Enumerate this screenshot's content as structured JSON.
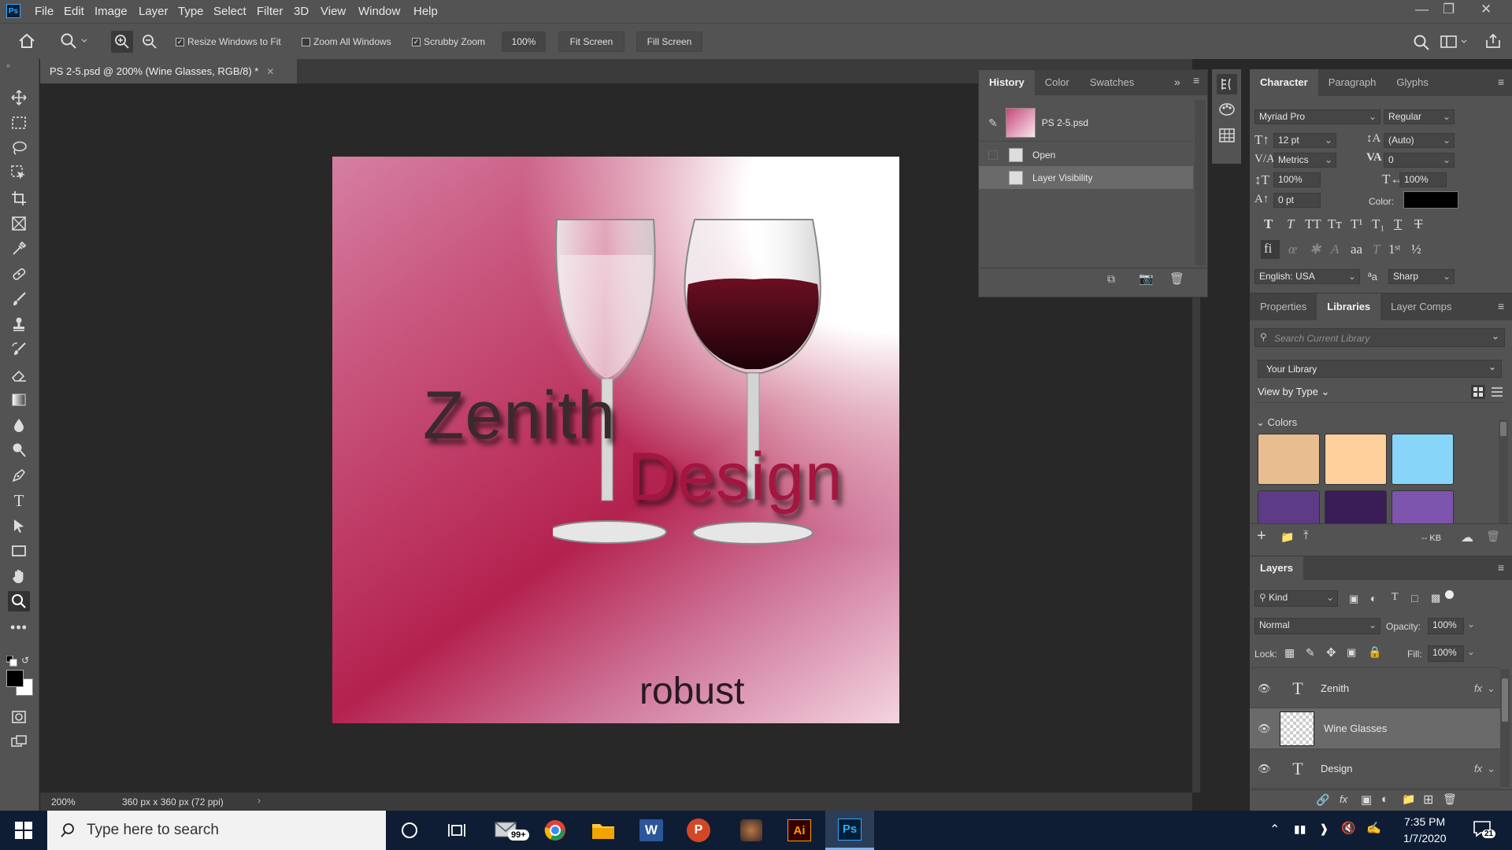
{
  "menubar": {
    "logo": "Ps",
    "items": [
      "File",
      "Edit",
      "Image",
      "Layer",
      "Type",
      "Select",
      "Filter",
      "3D",
      "View",
      "Window",
      "Help"
    ]
  },
  "options": {
    "resize_windows": "Resize Windows to Fit",
    "zoom_all": "Zoom All Windows",
    "scrubby": "Scrubby Zoom",
    "zoom_value": "100%",
    "fit_screen": "Fit Screen",
    "fill_screen": "Fill Screen"
  },
  "document": {
    "tab_title": "PS 2-5.psd @ 200% (Wine Glasses, RGB/8) *",
    "zoom": "200%",
    "dimensions": "360 px x 360 px (72 ppi)"
  },
  "canvas": {
    "zenith_text": "Zenith",
    "design_text": "Design",
    "robust_text": "robust"
  },
  "history": {
    "tabs": [
      "History",
      "Color",
      "Swatches"
    ],
    "snapshot": "PS 2-5.psd",
    "steps": [
      "Open",
      "Layer Visibility"
    ]
  },
  "character": {
    "tabs": [
      "Character",
      "Paragraph",
      "Glyphs"
    ],
    "font": "Myriad Pro",
    "style": "Regular",
    "size": "12 pt",
    "leading": "(Auto)",
    "kerning": "Metrics",
    "tracking": "0",
    "vscale": "100%",
    "hscale": "100%",
    "baseline": "0 pt",
    "color_label": "Color:",
    "language": "English: USA",
    "antialias": "Sharp",
    "aa_icon": "ªa"
  },
  "libraries": {
    "tabs": [
      "Properties",
      "Libraries",
      "Layer Comps"
    ],
    "search_placeholder": "Search Current Library",
    "library": "Your Library",
    "view": "View by Type",
    "section": "Colors",
    "size": "-- KB",
    "colors": [
      "#e8bd8f",
      "#fdd09c",
      "#88d5fa",
      "#5e3b87",
      "#3a1c57",
      "#7d54ae"
    ]
  },
  "layers": {
    "title": "Layers",
    "filter": "Kind",
    "blend": "Normal",
    "opacity_label": "Opacity:",
    "opacity": "100%",
    "lock_label": "Lock:",
    "fill_label": "Fill:",
    "fill": "100%",
    "items": [
      {
        "name": "Zenith",
        "fx": "fx"
      },
      {
        "name": "Wine Glasses"
      },
      {
        "name": "Design",
        "fx": "fx"
      }
    ]
  },
  "taskbar": {
    "search": "Type here to search",
    "time": "7:35 PM",
    "date": "1/7/2020",
    "notif": "21",
    "mail_badge": "99+"
  }
}
